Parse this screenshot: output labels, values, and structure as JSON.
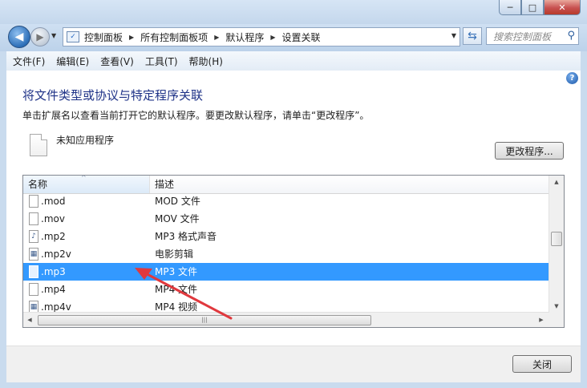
{
  "window": {
    "caption_minimize": "─",
    "caption_maximize": "□",
    "caption_close": "✕"
  },
  "nav": {
    "breadcrumbs": [
      "控制面板",
      "所有控制面板项",
      "默认程序",
      "设置关联"
    ],
    "search_placeholder": "搜索控制面板"
  },
  "menu": [
    "文件(F)",
    "编辑(E)",
    "查看(V)",
    "工具(T)",
    "帮助(H)"
  ],
  "page": {
    "title": "将文件类型或协议与特定程序关联",
    "description": "单击扩展名以查看当前打开它的默认程序。要更改默认程序，请单击“更改程序”。",
    "current_program": "未知应用程序",
    "change_button": "更改程序..."
  },
  "list": {
    "columns": [
      "名称",
      "描述"
    ],
    "rows": [
      {
        "ext": ".mod",
        "desc": "MOD 文件",
        "icon": "blank-file-icon",
        "selected": false
      },
      {
        "ext": ".mov",
        "desc": "MOV 文件",
        "icon": "blank-file-icon",
        "selected": false
      },
      {
        "ext": ".mp2",
        "desc": "MP3 格式声音",
        "icon": "audio-file-icon",
        "selected": false
      },
      {
        "ext": ".mp2v",
        "desc": "电影剪辑",
        "icon": "video-file-icon",
        "selected": false
      },
      {
        "ext": ".mp3",
        "desc": "MP3 文件",
        "icon": "blank-file-icon",
        "selected": true
      },
      {
        "ext": ".mp4",
        "desc": "MP4 文件",
        "icon": "blank-file-icon",
        "selected": false
      },
      {
        "ext": ".mp4v",
        "desc": "MP4 视频",
        "icon": "video-file-icon",
        "selected": false
      }
    ]
  },
  "footer": {
    "close_button": "关闭"
  },
  "colors": {
    "selection": "#3399ff",
    "title_text": "#1e3287",
    "annotation_arrow": "#e0393e"
  }
}
